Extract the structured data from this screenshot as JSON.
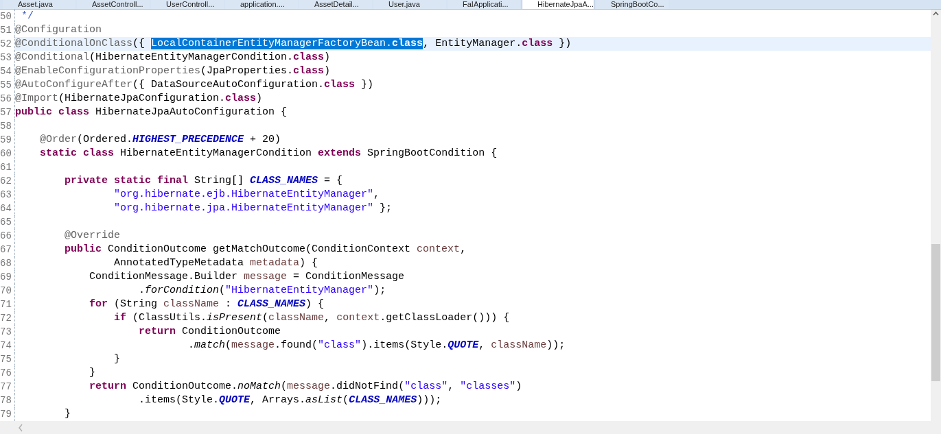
{
  "tabs": [
    {
      "label": "Asset.java",
      "selected": false
    },
    {
      "label": "AssetControll...",
      "selected": false
    },
    {
      "label": "UserControll...",
      "selected": false
    },
    {
      "label": "application....",
      "selected": false
    },
    {
      "label": "AssetDetail...",
      "selected": false
    },
    {
      "label": "User.java",
      "selected": false
    },
    {
      "label": "FaIApplicati...",
      "selected": false
    },
    {
      "label": "HibernateJpaA...",
      "selected": true
    },
    {
      "label": "SpringBootCo...",
      "selected": false
    }
  ],
  "lines": [
    {
      "number": "50",
      "current": false,
      "tokens": [
        {
          "kind": "comment",
          "text": " */"
        }
      ]
    },
    {
      "number": "51",
      "current": false,
      "tokens": [
        {
          "kind": "annotation",
          "text": "@Configuration"
        }
      ]
    },
    {
      "number": "52",
      "current": true,
      "tokens": [
        {
          "kind": "annotation",
          "text": "@ConditionalOnClass"
        },
        {
          "kind": "plain",
          "text": "({ "
        },
        {
          "kind": "selected",
          "text": "LocalContainerEntityManagerFactoryBean."
        },
        {
          "kind": "selected_keyword",
          "text": "class"
        },
        {
          "kind": "plain",
          "text": ", EntityManager."
        },
        {
          "kind": "keyword",
          "text": "class"
        },
        {
          "kind": "plain",
          "text": " })"
        }
      ]
    },
    {
      "number": "53",
      "current": false,
      "tokens": [
        {
          "kind": "annotation",
          "text": "@Conditional"
        },
        {
          "kind": "plain",
          "text": "(HibernateEntityManagerCondition."
        },
        {
          "kind": "keyword",
          "text": "class"
        },
        {
          "kind": "plain",
          "text": ")"
        }
      ]
    },
    {
      "number": "54",
      "current": false,
      "tokens": [
        {
          "kind": "annotation",
          "text": "@EnableConfigurationProperties"
        },
        {
          "kind": "plain",
          "text": "(JpaProperties."
        },
        {
          "kind": "keyword",
          "text": "class"
        },
        {
          "kind": "plain",
          "text": ")"
        }
      ]
    },
    {
      "number": "55",
      "current": false,
      "tokens": [
        {
          "kind": "annotation",
          "text": "@AutoConfigureAfter"
        },
        {
          "kind": "plain",
          "text": "({ DataSourceAutoConfiguration."
        },
        {
          "kind": "keyword",
          "text": "class"
        },
        {
          "kind": "plain",
          "text": " })"
        }
      ]
    },
    {
      "number": "56",
      "current": false,
      "tokens": [
        {
          "kind": "annotation",
          "text": "@Import"
        },
        {
          "kind": "plain",
          "text": "(HibernateJpaConfiguration."
        },
        {
          "kind": "keyword",
          "text": "class"
        },
        {
          "kind": "plain",
          "text": ")"
        }
      ]
    },
    {
      "number": "57",
      "current": false,
      "tokens": [
        {
          "kind": "keyword",
          "text": "public class"
        },
        {
          "kind": "plain",
          "text": " HibernateJpaAutoConfiguration {"
        }
      ]
    },
    {
      "number": "58",
      "current": false
    },
    {
      "number": "59",
      "current": false,
      "tokens": [
        {
          "kind": "annotation",
          "text": "    @Order"
        },
        {
          "kind": "plain",
          "text": "(Ordered."
        },
        {
          "kind": "constant",
          "text": "HIGHEST_PRECEDENCE"
        },
        {
          "kind": "plain",
          "text": " + 20)"
        }
      ]
    },
    {
      "number": "60",
      "current": false,
      "tokens": [
        {
          "kind": "keyword",
          "text": "    static class"
        },
        {
          "kind": "plain",
          "text": " HibernateEntityManagerCondition "
        },
        {
          "kind": "keyword",
          "text": "extends"
        },
        {
          "kind": "plain",
          "text": " SpringBootCondition {"
        }
      ]
    },
    {
      "number": "61",
      "current": false
    },
    {
      "number": "62",
      "current": false,
      "tokens": [
        {
          "kind": "keyword",
          "text": "        private static final"
        },
        {
          "kind": "plain",
          "text": " String[] "
        },
        {
          "kind": "constant",
          "text": "CLASS_NAMES"
        },
        {
          "kind": "plain",
          "text": " = {"
        }
      ]
    },
    {
      "number": "63",
      "current": false,
      "tokens": [
        {
          "kind": "string",
          "text": "                \"org.hibernate.ejb.HibernateEntityManager\""
        },
        {
          "kind": "plain",
          "text": ","
        }
      ]
    },
    {
      "number": "64",
      "current": false,
      "tokens": [
        {
          "kind": "string",
          "text": "                \"org.hibernate.jpa.HibernateEntityManager\""
        },
        {
          "kind": "plain",
          "text": " };"
        }
      ]
    },
    {
      "number": "65",
      "current": false
    },
    {
      "number": "66",
      "current": false,
      "tokens": [
        {
          "kind": "annotation",
          "text": "        @Override"
        }
      ]
    },
    {
      "number": "67",
      "current": false,
      "tokens": [
        {
          "kind": "keyword",
          "text": "        public"
        },
        {
          "kind": "plain",
          "text": " ConditionOutcome getMatchOutcome(ConditionContext "
        },
        {
          "kind": "variable",
          "text": "context"
        },
        {
          "kind": "plain",
          "text": ","
        }
      ]
    },
    {
      "number": "68",
      "current": false,
      "tokens": [
        {
          "kind": "plain",
          "text": "                AnnotatedTypeMetadata "
        },
        {
          "kind": "variable",
          "text": "metadata"
        },
        {
          "kind": "plain",
          "text": ") {"
        }
      ]
    },
    {
      "number": "69",
      "current": false,
      "tokens": [
        {
          "kind": "plain",
          "text": "            ConditionMessage.Builder "
        },
        {
          "kind": "variable",
          "text": "message"
        },
        {
          "kind": "plain",
          "text": " = ConditionMessage"
        }
      ]
    },
    {
      "number": "70",
      "current": false,
      "tokens": [
        {
          "kind": "plain",
          "text": "                    ."
        },
        {
          "kind": "static",
          "text": "forCondition"
        },
        {
          "kind": "plain",
          "text": "("
        },
        {
          "kind": "string",
          "text": "\"HibernateEntityManager\""
        },
        {
          "kind": "plain",
          "text": ");"
        }
      ]
    },
    {
      "number": "71",
      "current": false,
      "tokens": [
        {
          "kind": "keyword",
          "text": "            for"
        },
        {
          "kind": "plain",
          "text": " (String "
        },
        {
          "kind": "variable",
          "text": "className"
        },
        {
          "kind": "plain",
          "text": " : "
        },
        {
          "kind": "constant",
          "text": "CLASS_NAMES"
        },
        {
          "kind": "plain",
          "text": ") {"
        }
      ]
    },
    {
      "number": "72",
      "current": false,
      "tokens": [
        {
          "kind": "keyword",
          "text": "                if"
        },
        {
          "kind": "plain",
          "text": " (ClassUtils."
        },
        {
          "kind": "static",
          "text": "isPresent"
        },
        {
          "kind": "plain",
          "text": "("
        },
        {
          "kind": "variable",
          "text": "className"
        },
        {
          "kind": "plain",
          "text": ", "
        },
        {
          "kind": "variable",
          "text": "context"
        },
        {
          "kind": "plain",
          "text": ".getClassLoader())) {"
        }
      ]
    },
    {
      "number": "73",
      "current": false,
      "tokens": [
        {
          "kind": "keyword",
          "text": "                    return"
        },
        {
          "kind": "plain",
          "text": " ConditionOutcome"
        }
      ]
    },
    {
      "number": "74",
      "current": false,
      "tokens": [
        {
          "kind": "plain",
          "text": "                            ."
        },
        {
          "kind": "static",
          "text": "match"
        },
        {
          "kind": "plain",
          "text": "("
        },
        {
          "kind": "variable",
          "text": "message"
        },
        {
          "kind": "plain",
          "text": ".found("
        },
        {
          "kind": "string",
          "text": "\"class\""
        },
        {
          "kind": "plain",
          "text": ").items(Style."
        },
        {
          "kind": "constant",
          "text": "QUOTE"
        },
        {
          "kind": "plain",
          "text": ", "
        },
        {
          "kind": "variable",
          "text": "className"
        },
        {
          "kind": "plain",
          "text": "));"
        }
      ]
    },
    {
      "number": "75",
      "current": false,
      "tokens": [
        {
          "kind": "plain",
          "text": "                }"
        }
      ]
    },
    {
      "number": "76",
      "current": false,
      "tokens": [
        {
          "kind": "plain",
          "text": "            }"
        }
      ]
    },
    {
      "number": "77",
      "current": false,
      "tokens": [
        {
          "kind": "keyword",
          "text": "            return"
        },
        {
          "kind": "plain",
          "text": " ConditionOutcome."
        },
        {
          "kind": "static",
          "text": "noMatch"
        },
        {
          "kind": "plain",
          "text": "("
        },
        {
          "kind": "variable",
          "text": "message"
        },
        {
          "kind": "plain",
          "text": ".didNotFind("
        },
        {
          "kind": "string",
          "text": "\"class\""
        },
        {
          "kind": "plain",
          "text": ", "
        },
        {
          "kind": "string",
          "text": "\"classes\""
        },
        {
          "kind": "plain",
          "text": ")"
        }
      ]
    },
    {
      "number": "78",
      "current": false,
      "tokens": [
        {
          "kind": "plain",
          "text": "                    .items(Style."
        },
        {
          "kind": "constant",
          "text": "QUOTE"
        },
        {
          "kind": "plain",
          "text": ", Arrays."
        },
        {
          "kind": "static",
          "text": "asList"
        },
        {
          "kind": "plain",
          "text": "("
        },
        {
          "kind": "constant",
          "text": "CLASS_NAMES"
        },
        {
          "kind": "plain",
          "text": ")));"
        }
      ]
    },
    {
      "number": "79",
      "current": false,
      "tokens": [
        {
          "kind": "plain",
          "text": "        }"
        }
      ]
    }
  ]
}
